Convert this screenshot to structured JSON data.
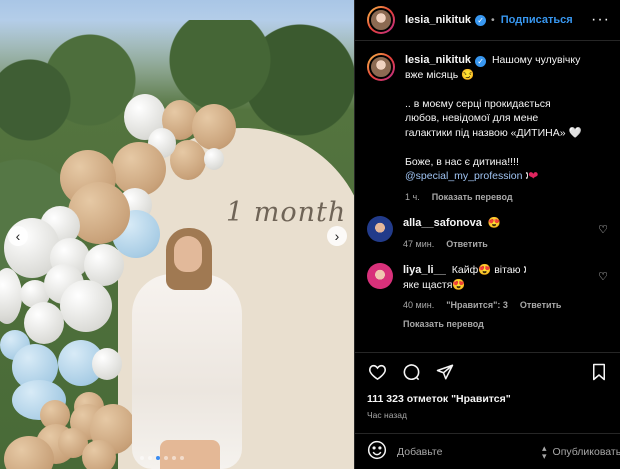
{
  "header": {
    "username": "lesia_nikituk",
    "follow_label": "Подписаться",
    "more_icon": "more-horizontal-icon"
  },
  "photo": {
    "overlay_text": "1 month",
    "prev_icon": "chevron-left-icon",
    "next_icon": "chevron-right-icon",
    "dots_count": 6,
    "active_dot": 2
  },
  "caption": {
    "username": "lesia_nikituk",
    "lines": [
      "Нашому чулувічку",
      "вже місяць 😏",
      "",
      ".. в моєму серці прокидається",
      "любов, невідомої для мене",
      "галактики під назвою «ДИТИНА» 🤍",
      "",
      "Боже, в нас є дитина!!!!",
      "@special_my_profession 🕽 ❤"
    ],
    "mention": "@special_my_profession",
    "time": "1 ч.",
    "translate": "Показать перевод"
  },
  "comments": [
    {
      "username": "alla__safonova",
      "text": "😍",
      "time": "47 мин.",
      "reply": "Ответить"
    },
    {
      "username": "liya_li__",
      "text_line1": "Кайф😍 вітаю 🕽",
      "text_line2": "яке щастя😍",
      "time": "40 мин.",
      "likes": "\"Нравится\": 3",
      "reply": "Ответить",
      "translate": "Показать перевод"
    }
  ],
  "actions": {
    "likes_text": "111 323 отметок \"Нравится\"",
    "posted_time": "Час назад"
  },
  "add_comment": {
    "placeholder": "Добавьте",
    "publish_label": "Опубликовать"
  },
  "colors": {
    "accent": "#3897f0",
    "background": "#000000",
    "muted": "#a8a8a8"
  }
}
